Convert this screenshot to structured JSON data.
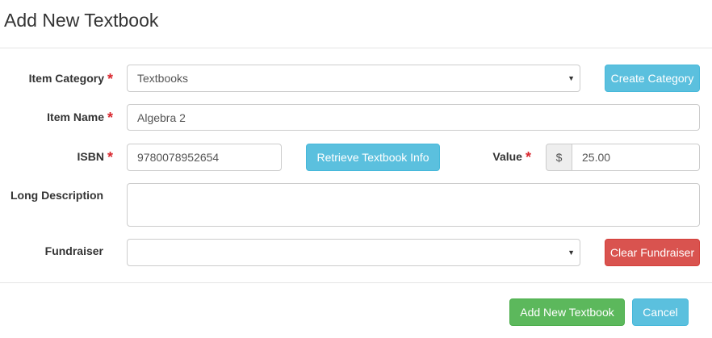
{
  "modal": {
    "title": "Add New Textbook"
  },
  "form": {
    "item_category": {
      "label": "Item Category",
      "required_mark": "*",
      "value": "Textbooks"
    },
    "item_name": {
      "label": "Item Name",
      "required_mark": "*",
      "value": "Algebra 2"
    },
    "isbn": {
      "label": "ISBN",
      "required_mark": "*",
      "value": "9780078952654"
    },
    "value": {
      "label": "Value",
      "required_mark": "*",
      "currency_symbol": "$",
      "amount": "25.00"
    },
    "long_description": {
      "label": "Long Description",
      "value": ""
    },
    "fundraiser": {
      "label": "Fundraiser",
      "value": ""
    }
  },
  "buttons": {
    "create_category": "Create Category",
    "retrieve_textbook_info": "Retrieve Textbook Info",
    "clear_fundraiser": "Clear Fundraiser",
    "add_new_textbook": "Add New Textbook",
    "cancel": "Cancel"
  },
  "icons": {
    "select_caret": "▼"
  },
  "colors": {
    "info": "#5bc0de",
    "danger": "#d9534f",
    "success": "#5cb85c",
    "required": "#d9282f"
  }
}
